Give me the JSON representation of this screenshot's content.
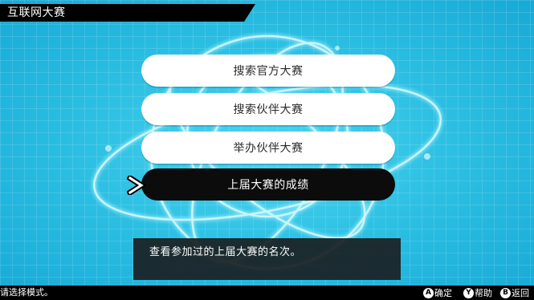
{
  "header": {
    "title": "互联网大赛"
  },
  "menu": {
    "items": [
      {
        "label": "搜索官方大赛",
        "selected": false
      },
      {
        "label": "搜索伙伴大赛",
        "selected": false
      },
      {
        "label": "举办伙伴大赛",
        "selected": false
      },
      {
        "label": "上届大赛的成绩",
        "selected": true
      }
    ]
  },
  "description": {
    "text": "查看参加过的上届大赛的名次。"
  },
  "footer": {
    "hint": "请选择模式。",
    "controls": [
      {
        "button": "A",
        "label": "确定",
        "icon": "a-button-icon"
      },
      {
        "button": "Y",
        "label": "帮助",
        "icon": "y-button-icon"
      },
      {
        "button": "B",
        "label": "返回",
        "icon": "b-button-icon"
      }
    ]
  },
  "colors": {
    "background": "#2ec1e4",
    "selected": "#0c0c0c",
    "option": "#ffffff",
    "title_bar": "#000000"
  }
}
